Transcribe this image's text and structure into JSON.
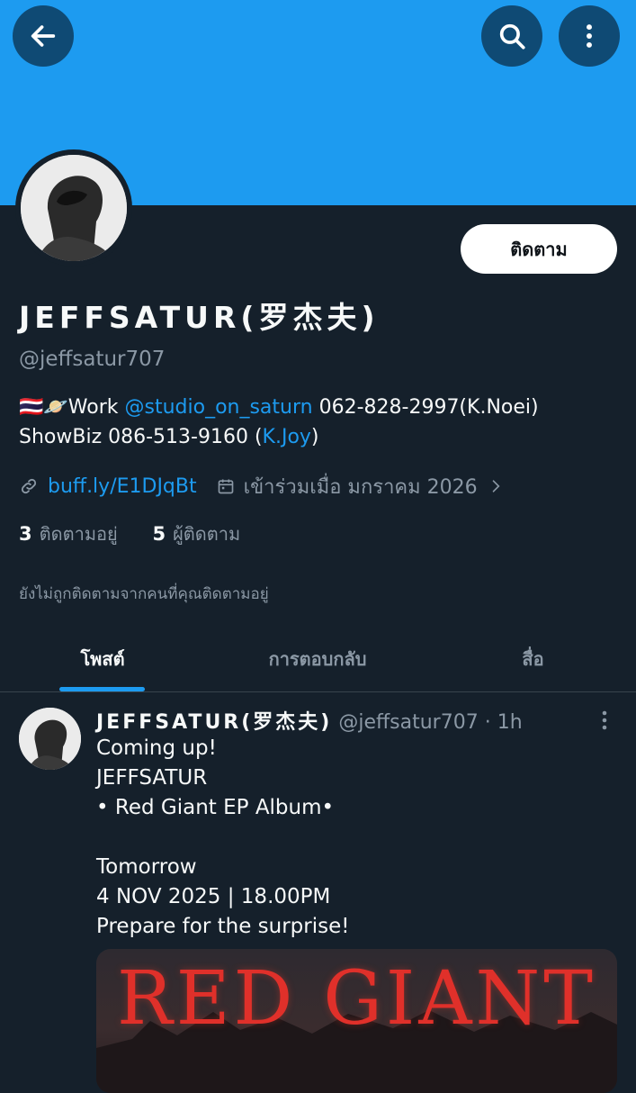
{
  "header": {
    "back_icon": "arrow-left-icon",
    "search_icon": "search-icon",
    "more_icon": "more-vertical-icon",
    "banner_color": "#1d9bf0"
  },
  "profile": {
    "display_name": "JEFFSATUR(罗杰夫)",
    "handle": "@jeffsatur707",
    "follow_label": "ติดตาม",
    "bio": {
      "flags": "🇹🇭🪐",
      "work_label": "Work ",
      "work_mention": "@studio_on_saturn",
      "work_phone": " 062-828-2997(K.Noei)",
      "showbiz_text": "ShowBiz  086-513-9160 (",
      "showbiz_mention": "K.Joy",
      "showbiz_close": ")"
    },
    "link_text": "buff.ly/E1DJqBt",
    "joined_text": "เข้าร่วมเมื่อ มกราคม 2026",
    "following_count": "3",
    "following_label": "ติดตามอยู่",
    "followers_count": "5",
    "followers_label": "ผู้ติดตาม",
    "not_followed_text": "ยังไม่ถูกติดตามจากคนที่คุณติดตามอยู่"
  },
  "tabs": [
    {
      "label": "โพสต์",
      "active": true
    },
    {
      "label": "การตอบกลับ",
      "active": false
    },
    {
      "label": "สื่อ",
      "active": false
    }
  ],
  "tweet": {
    "name": "JEFFSATUR(罗杰夫)",
    "handle": "@jeffsatur707",
    "separator": " · ",
    "time": "1h",
    "text": "Coming up!\nJEFFSATUR\n• Red Giant EP Album•\n\nTomorrow\n4 NOV 2025 | 18.00PM\nPrepare for the surprise!",
    "media_title": "RED GIANT"
  },
  "colors": {
    "background": "#15202b",
    "accent": "#1d9bf0",
    "muted_text": "#8b98a5",
    "media_red": "#e0302a"
  }
}
